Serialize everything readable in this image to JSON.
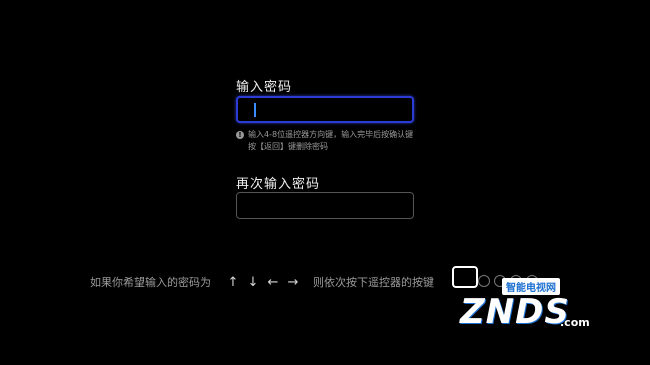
{
  "password": {
    "label": "输入密码",
    "value": "",
    "hint_line1": "输入4-8位遥控器方向键，输入完毕后按确认键",
    "hint_line2": "按【返回】键删除密码",
    "info_icon_symbol": "!"
  },
  "confirm_password": {
    "label": "再次输入密码",
    "value": ""
  },
  "example": {
    "prefix": "如果你希望输入的密码为",
    "arrows": [
      "↑",
      "↓",
      "←",
      "→"
    ],
    "suffix": "则依次按下遥控器的按键"
  },
  "watermark": {
    "badge": "智能电视网",
    "logo": "ZNDS",
    "domain": ".com"
  },
  "colors": {
    "focus_border": "#2b3bd6",
    "caret": "#3a8cff"
  }
}
